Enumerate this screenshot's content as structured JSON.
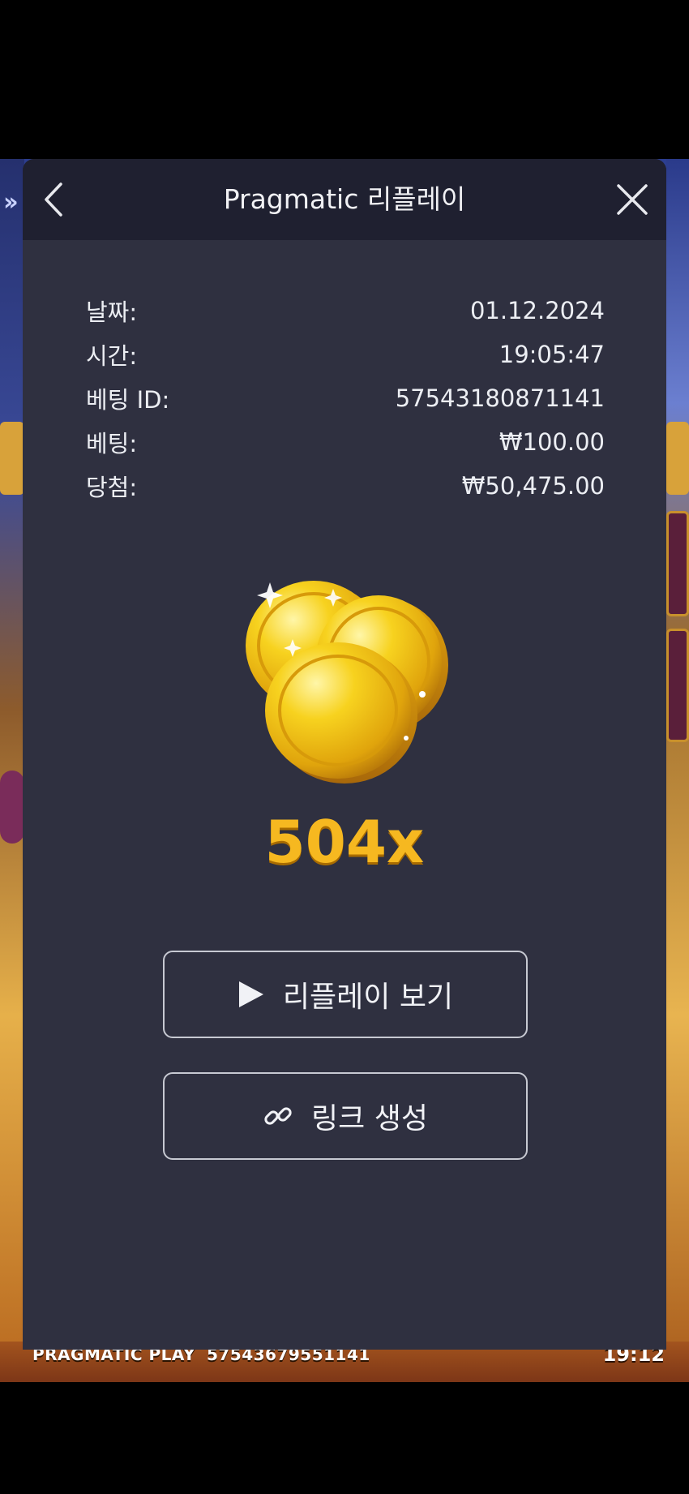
{
  "modal": {
    "title": "Pragmatic 리플레이",
    "back_icon": "chevron-left-icon",
    "close_icon": "close-icon"
  },
  "details": [
    {
      "label": "날짜:",
      "value": "01.12.2024"
    },
    {
      "label": "시간:",
      "value": "19:05:47"
    },
    {
      "label": "베팅 ID:",
      "value": "57543180871141"
    },
    {
      "label": "베팅:",
      "value": "₩100.00"
    },
    {
      "label": "당첨:",
      "value": "₩50,475.00"
    }
  ],
  "result": {
    "image": "gold-coins-image",
    "multiplier": "504x"
  },
  "actions": {
    "replay_label": "리플레이 보기",
    "replay_icon": "play-icon",
    "link_label": "링크 생성",
    "link_icon": "link-icon"
  },
  "background": {
    "provider": "PRAGMATIC PLAY",
    "round_id": "57543679551141",
    "time": "19:12"
  },
  "colors": {
    "modal_bg": "#2f3040",
    "header_bg": "#1f2030",
    "multiplier": "#f6b820"
  }
}
